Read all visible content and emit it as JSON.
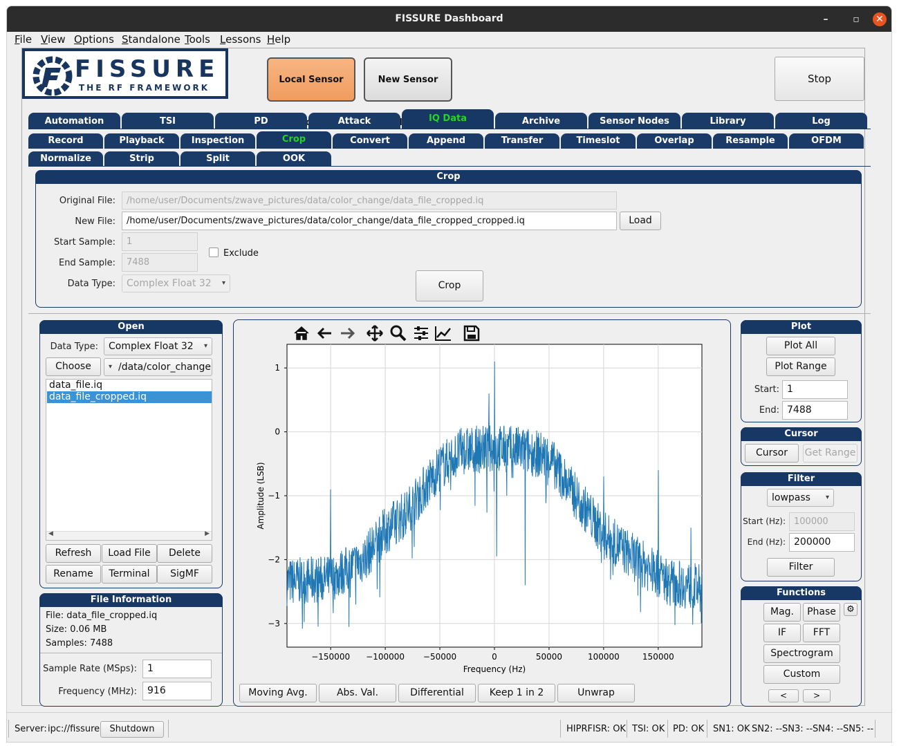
{
  "window": {
    "title": "FISSURE Dashboard"
  },
  "menu": [
    "File",
    "View",
    "Options",
    "Standalone",
    "Tools",
    "Lessons",
    "Help"
  ],
  "logo": {
    "title": "FISSURE",
    "subtitle": "THE RF FRAMEWORK"
  },
  "top_buttons": {
    "local": "Local Sensor Node",
    "new": "New Sensor Node",
    "stop": "Stop"
  },
  "main_tabs": [
    "Automation",
    "TSI",
    "PD",
    "Attack",
    "IQ Data",
    "Archive",
    "Sensor Nodes",
    "Library",
    "Log"
  ],
  "active_main_tab": "IQ Data",
  "sub_tabs_row1": [
    "Record",
    "Playback",
    "Inspection",
    "Crop",
    "Convert",
    "Append",
    "Transfer",
    "Timeslot",
    "Overlap",
    "Resample",
    "OFDM"
  ],
  "sub_tabs_row2": [
    "Normalize",
    "Strip",
    "Split",
    "OOK"
  ],
  "active_sub_tab": "Crop",
  "crop": {
    "title": "Crop",
    "original_file_label": "Original File:",
    "original_file": "/home/user/Documents/zwave_pictures/data/color_change/data_file_cropped.iq",
    "new_file_label": "New File:",
    "new_file": "/home/user/Documents/zwave_pictures/data/color_change/data_file_cropped_cropped.iq",
    "load": "Load",
    "start_sample_label": "Start Sample:",
    "start_sample": "1",
    "end_sample_label": "End Sample:",
    "end_sample": "7488",
    "exclude": "Exclude",
    "data_type_label": "Data Type:",
    "data_type": "Complex Float 32",
    "crop_button": "Crop"
  },
  "open": {
    "title": "Open",
    "data_type_label": "Data Type:",
    "data_type": "Complex Float 32",
    "choose": "Choose",
    "folder": "/data/color_change",
    "files": [
      "data_file.iq",
      "data_file_cropped.iq"
    ],
    "selected": "data_file_cropped.iq",
    "buttons": [
      "Refresh",
      "Load File",
      "Delete",
      "Rename",
      "Terminal",
      "SigMF"
    ]
  },
  "file_info": {
    "title": "File Information",
    "file": "File: data_file_cropped.iq",
    "size": "Size: 0.06 MB",
    "samples": "Samples: 7488",
    "sample_rate_label": "Sample Rate (MSps):",
    "sample_rate": "1",
    "frequency_label": "Frequency (MHz):",
    "frequency": "916"
  },
  "toolbar_icons": [
    "home-icon",
    "back-arrow-icon",
    "forward-arrow-icon",
    "pan-icon",
    "zoom-icon",
    "configure-subplots-icon",
    "edit-axis-icon",
    "save-icon"
  ],
  "chart_data": {
    "type": "line",
    "xlabel": "Frequency (Hz)",
    "ylabel": "Amplitude (LSB)",
    "xlim": [
      -190000,
      190000
    ],
    "ylim": [
      -3.37,
      1.37
    ],
    "xticks": [
      -150000,
      -100000,
      -50000,
      0,
      50000,
      100000,
      150000
    ],
    "xtick_labels": [
      "−150000",
      "−100000",
      "−50000",
      "0",
      "50000",
      "100000",
      "150000"
    ],
    "yticks": [
      1,
      0,
      -1,
      -2,
      -3
    ],
    "ytick_labels": [
      "1",
      "0",
      "−1",
      "−2",
      "−3"
    ],
    "grid": true,
    "color": "#1f77b4",
    "envelope": {
      "x": [
        -190000,
        -150000,
        -120000,
        -100000,
        -80000,
        -50000,
        -30000,
        0,
        30000,
        50000,
        70000,
        100000,
        130000,
        160000,
        190000
      ],
      "y": [
        -2.35,
        -2.3,
        -2.0,
        -1.55,
        -1.25,
        -0.55,
        -0.3,
        -0.25,
        -0.3,
        -0.4,
        -0.9,
        -1.6,
        -2.0,
        -2.35,
        -2.45
      ]
    },
    "spikes": [
      {
        "x": 0,
        "y": 1.1
      },
      {
        "x": 2000,
        "y": -1.95
      },
      {
        "x": -5000,
        "y": 0.6
      },
      {
        "x": -150000,
        "y": -0.9
      },
      {
        "x": 100000,
        "y": -0.7
      },
      {
        "x": 150000,
        "y": -0.6
      },
      {
        "x": 180000,
        "y": -1.5
      },
      {
        "x": 28000,
        "y": -2.4
      }
    ]
  },
  "plot_buttons": [
    "Moving Avg.",
    "Abs. Val.",
    "Differential",
    "Keep 1 in 2",
    "Unwrap"
  ],
  "plot_panel": {
    "title": "Plot",
    "plot_all": "Plot All",
    "plot_range": "Plot Range",
    "start_label": "Start:",
    "start": "1",
    "end_label": "End:",
    "end": "7488"
  },
  "cursor_panel": {
    "title": "Cursor",
    "cursor": "Cursor",
    "get_range": "Get Range"
  },
  "filter_panel": {
    "title": "Filter",
    "type": "lowpass",
    "start_label": "Start (Hz):",
    "start": "100000",
    "end_label": "End (Hz):",
    "end": "200000",
    "filter": "Filter"
  },
  "functions_panel": {
    "title": "Functions",
    "mag": "Mag.",
    "phase": "Phase",
    "if": "IF",
    "fft": "FFT",
    "spectrogram": "Spectrogram",
    "custom": "Custom",
    "prev": "<",
    "next": ">"
  },
  "status": {
    "server_label": "Server:",
    "server": "ipc://fissure",
    "shutdown": "Shutdown",
    "hiprfisr": "HIPRFISR: OK",
    "tsi": "TSI: OK",
    "pd": "PD: OK",
    "sn1": "SN1: OK",
    "sn2": "SN2: --",
    "sn3": "SN3: --",
    "sn4": "SN4: --",
    "sn5": "SN5: --"
  }
}
